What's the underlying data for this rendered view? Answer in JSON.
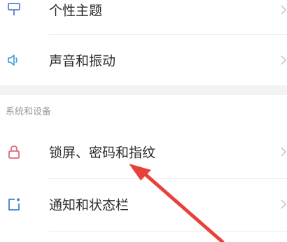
{
  "settings": {
    "rows": [
      {
        "label": "个性主题",
        "icon": "theme-icon"
      },
      {
        "label": "声音和振动",
        "icon": "speaker-icon"
      }
    ],
    "section_header": "系统和设备",
    "section_rows": [
      {
        "label": "锁屏、密码和指纹",
        "icon": "lock-icon"
      },
      {
        "label": "通知和状态栏",
        "icon": "notification-icon"
      }
    ]
  },
  "annotation": {
    "arrow_color": "#e8413a"
  },
  "colors": {
    "theme_icon": "#5b7fc8",
    "speaker_icon": "#4da3d9",
    "lock_icon": "#e06a7a",
    "notification_icon": "#3f7fd6",
    "section_background": "#f3f3f5"
  }
}
